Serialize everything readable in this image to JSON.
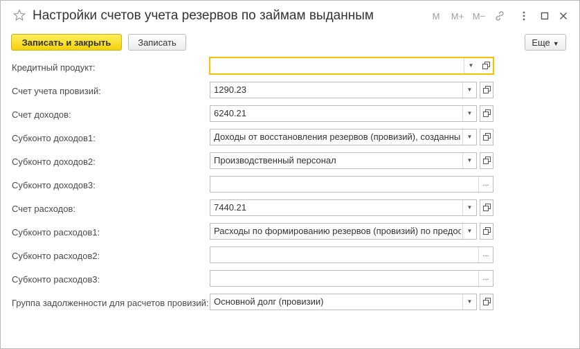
{
  "window": {
    "title": "Настройки счетов учета резервов по займам выданным",
    "controls": {
      "m": "M",
      "m_plus": "M+",
      "m_minus": "M−"
    }
  },
  "toolbar": {
    "save_close_label": "Записать и закрыть",
    "save_label": "Записать",
    "more_label": "Еще"
  },
  "form": {
    "fields": [
      {
        "label": "Кредитный продукт:",
        "value": ""
      },
      {
        "label": "Счет учета провизий:",
        "value": "1290.23"
      },
      {
        "label": "Счет доходов:",
        "value": "6240.21"
      },
      {
        "label": "Субконто доходов1:",
        "value": "Доходы от восстановления резервов (провизий), созданных"
      },
      {
        "label": "Субконто доходов2:",
        "value": "Производственный персонал"
      },
      {
        "label": "Субконто доходов3:",
        "value": ""
      },
      {
        "label": "Счет расходов:",
        "value": "7440.21"
      },
      {
        "label": "Субконто расходов1:",
        "value": "Расходы по формированию резервов (провизий) по предост"
      },
      {
        "label": "Субконто расходов2:",
        "value": ""
      },
      {
        "label": "Субконто расходов3:",
        "value": ""
      },
      {
        "label": "Группа задолженности для расчетов провизий:",
        "value": "Основной долг (провизии)"
      }
    ]
  },
  "colors": {
    "accent_yellow": "#f5c400",
    "border": "#bdbdbd",
    "text": "#4a4a4a"
  }
}
